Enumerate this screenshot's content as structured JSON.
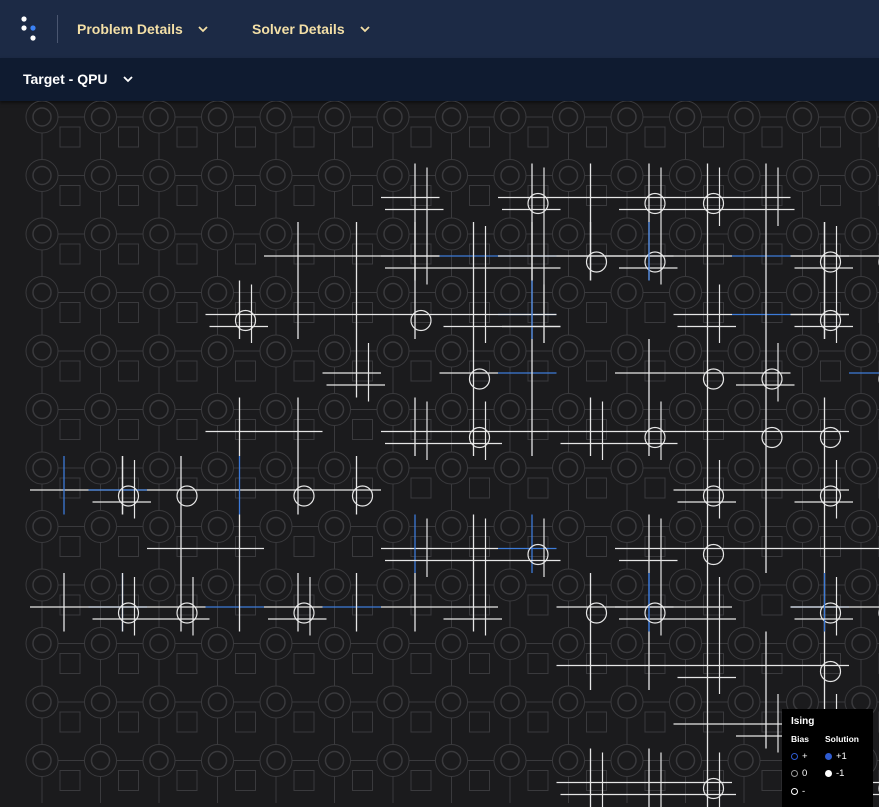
{
  "topbar": {
    "logo_icon": "dwave-dots-logo",
    "menus": [
      {
        "label": "Problem Details"
      },
      {
        "label": "Solver Details"
      }
    ]
  },
  "subbar": {
    "target_label": "Target - QPU"
  },
  "legend": {
    "title": "Ising",
    "bias_header": "Bias",
    "solution_header": "Solution",
    "bias_items": [
      {
        "symbol": "+",
        "color": "#2e5bd1"
      },
      {
        "symbol": "0",
        "color": "#9a9a9a"
      },
      {
        "symbol": "-",
        "color": "#ffffff"
      }
    ],
    "solution_items": [
      {
        "symbol": "+1",
        "color": "#2e5bd1"
      },
      {
        "symbol": "-1",
        "color": "#ffffff"
      }
    ]
  },
  "colors": {
    "topbar": "#1c2a45",
    "subbar": "#0f1b30",
    "menu_text": "#f3dfa6",
    "coupler_idle": "#3a3a3d",
    "coupler_active": "#e6e6e6",
    "coupler_positive": "#3d7bd8",
    "background": "#1b1b1d"
  }
}
